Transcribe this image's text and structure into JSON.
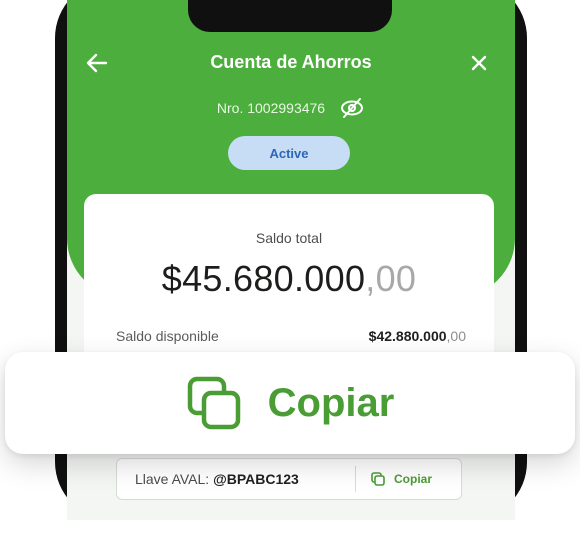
{
  "header": {
    "title": "Cuenta de Ahorros",
    "back_icon": "arrow-left-icon",
    "close_icon": "close-icon"
  },
  "account": {
    "number": "Nro. 1002993476",
    "visibility_icon": "eye-off-icon",
    "status": "Active"
  },
  "balance": {
    "label": "Saldo total",
    "main": "$45.680.000",
    "cents": ",00",
    "available_label": "Saldo disponible",
    "available_main": "$42.880.000",
    "available_cents": ",00"
  },
  "copy_overlay": {
    "label": "Copiar",
    "icon": "copy-icon"
  },
  "key": {
    "label": "Llave AVAL:",
    "value": "@BPABC123",
    "copy_label": "Copiar"
  },
  "colors": {
    "brand_green": "#4cae3c",
    "copy_green": "#4a9c35",
    "status_bg": "#c7ddf6",
    "status_text": "#2c67b7"
  }
}
